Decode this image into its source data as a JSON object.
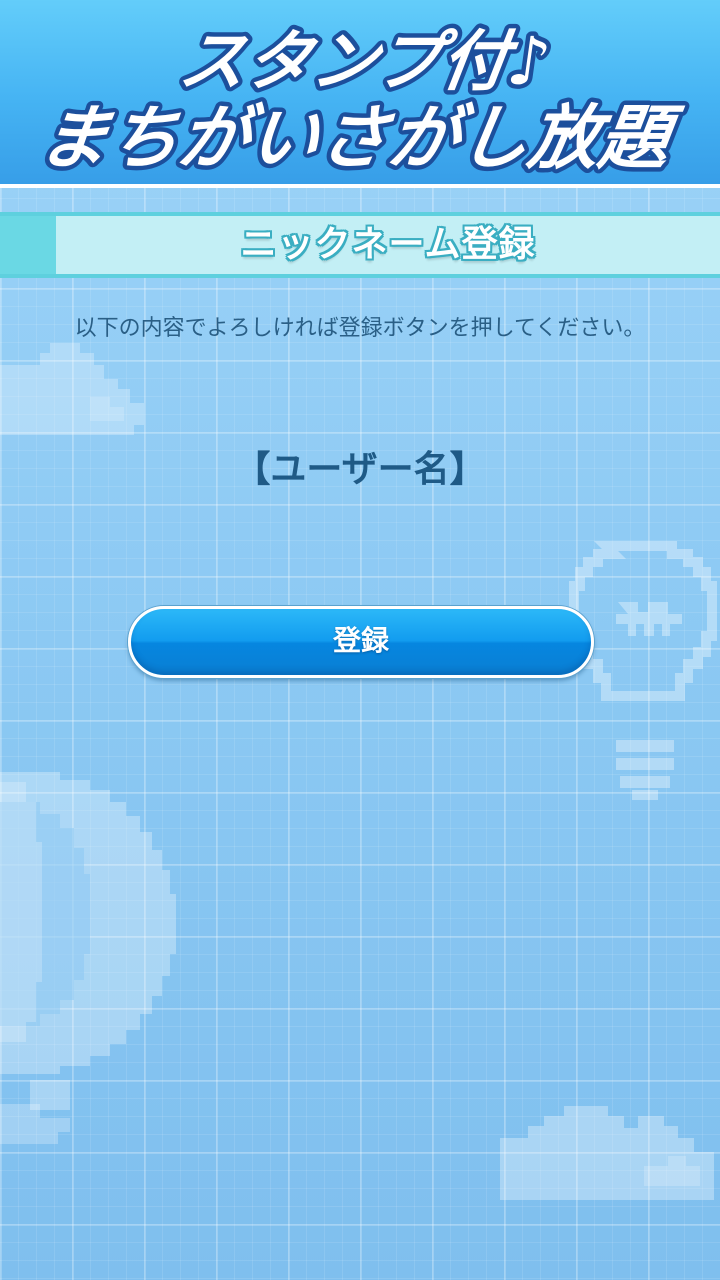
{
  "header": {
    "logo_line1": "スタンプ付♪",
    "logo_line2": "まちがいさがし放題"
  },
  "section": {
    "title": "ニックネーム登録"
  },
  "main": {
    "instruction": "以下の内容でよろしければ登録ボタンを押してください。",
    "username": "【ユーザー名】",
    "register_label": "登録"
  },
  "colors": {
    "header_blue": "#45b3f3",
    "button_blue": "#129cef",
    "section_teal": "#5ed0de",
    "text_dark_blue": "#1f5a86"
  },
  "decorations": [
    "cloud-icon",
    "light-bulb-icon",
    "hot-air-balloon-icon",
    "cloud-icon"
  ]
}
